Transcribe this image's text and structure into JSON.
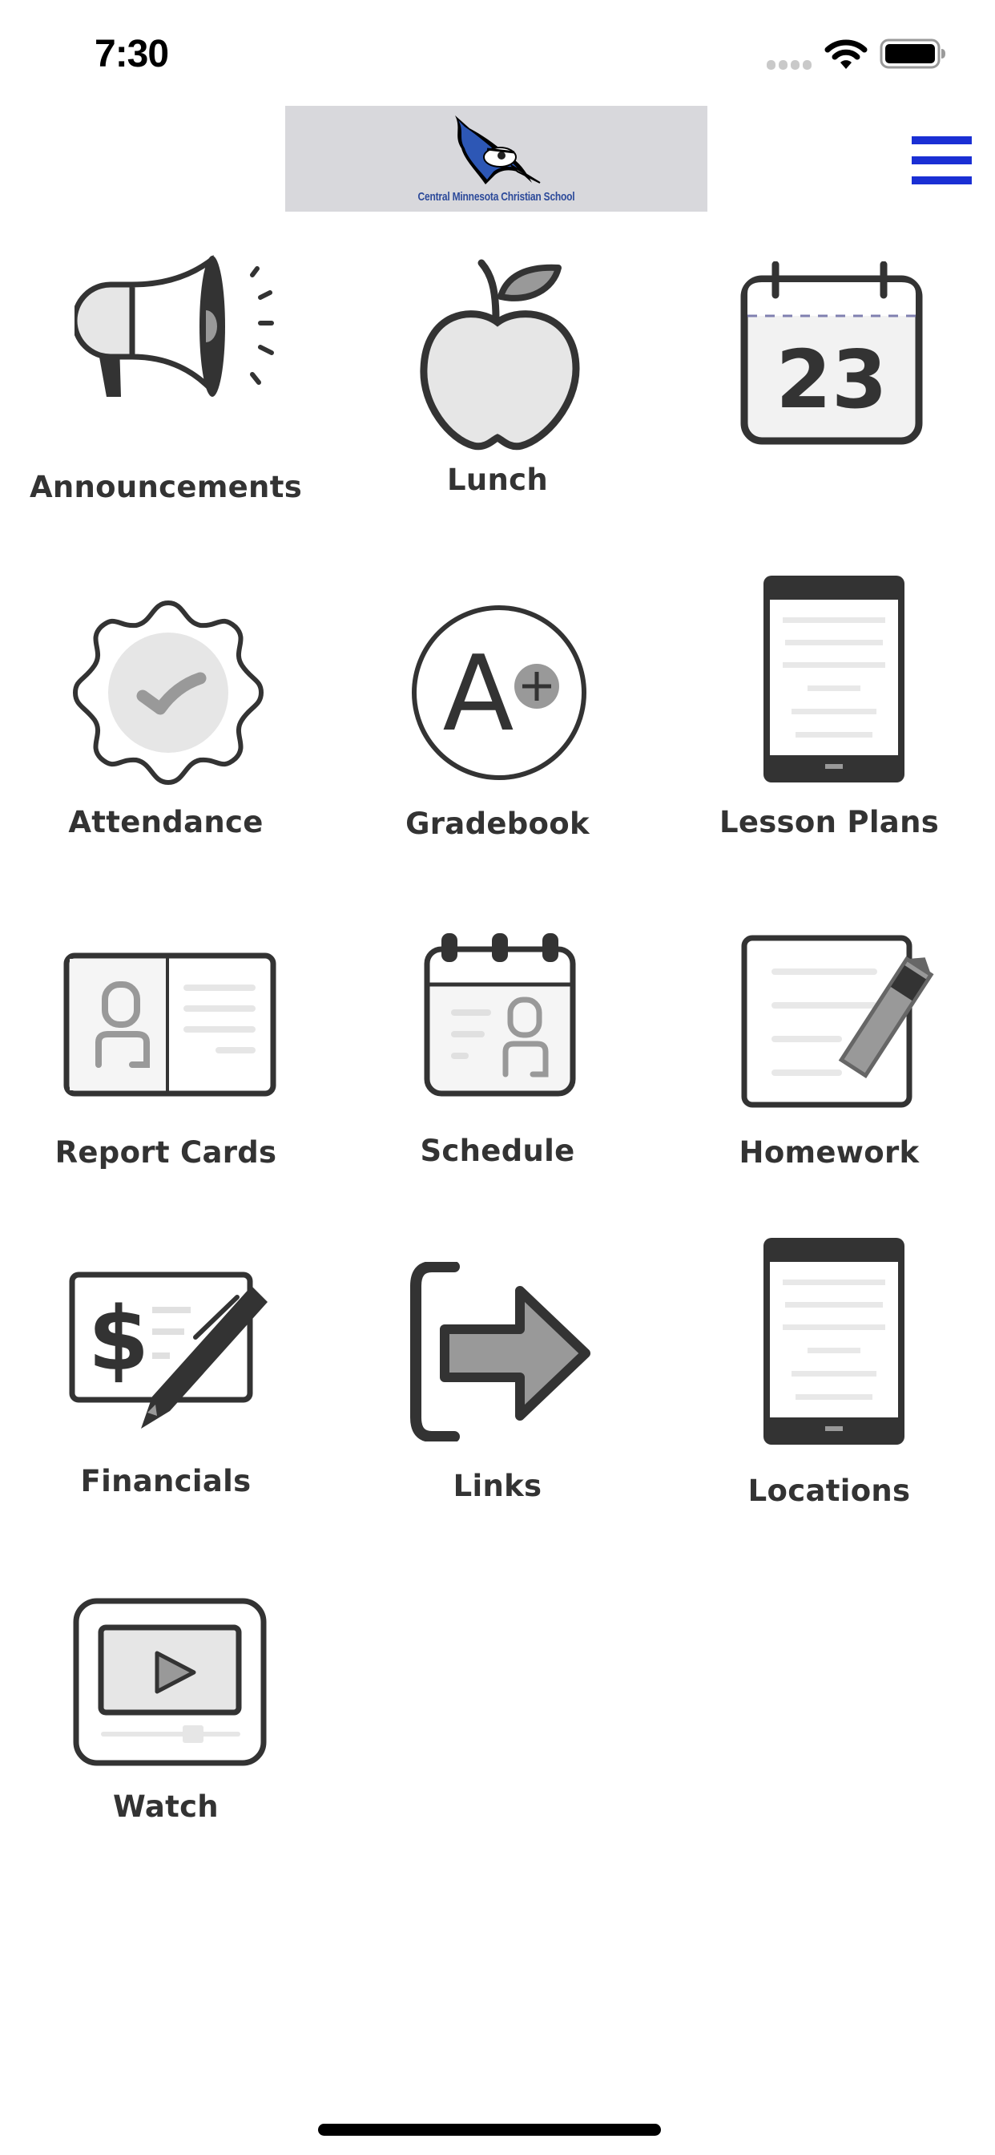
{
  "status_bar": {
    "time": "7:30",
    "icons": [
      "cellular-signal-icon",
      "wifi-icon",
      "battery-icon"
    ]
  },
  "header": {
    "logo_text": "Central Minnesota Christian School",
    "logo_icon": "bluejay-mascot-icon",
    "menu_icon": "hamburger-menu-icon",
    "accent_color": "#1a2fd4"
  },
  "calendar_day": "23",
  "grid": {
    "items": [
      {
        "label": "Announcements",
        "icon": "megaphone-icon"
      },
      {
        "label": "Lunch",
        "icon": "apple-icon"
      },
      {
        "label": "",
        "icon": "calendar-icon"
      },
      {
        "label": "Attendance",
        "icon": "checkmark-badge-icon"
      },
      {
        "label": "Gradebook",
        "icon": "a-plus-grade-icon"
      },
      {
        "label": "Lesson Plans",
        "icon": "tablet-document-icon"
      },
      {
        "label": "Report Cards",
        "icon": "report-card-icon"
      },
      {
        "label": "Schedule",
        "icon": "schedule-calendar-icon"
      },
      {
        "label": "Homework",
        "icon": "document-pencil-icon"
      },
      {
        "label": "Financials",
        "icon": "check-dollar-pen-icon"
      },
      {
        "label": "Links",
        "icon": "external-link-arrow-icon"
      },
      {
        "label": "Locations",
        "icon": "tablet-document-icon"
      },
      {
        "label": "Watch",
        "icon": "video-player-icon"
      }
    ]
  },
  "gradebook_grade": "A"
}
